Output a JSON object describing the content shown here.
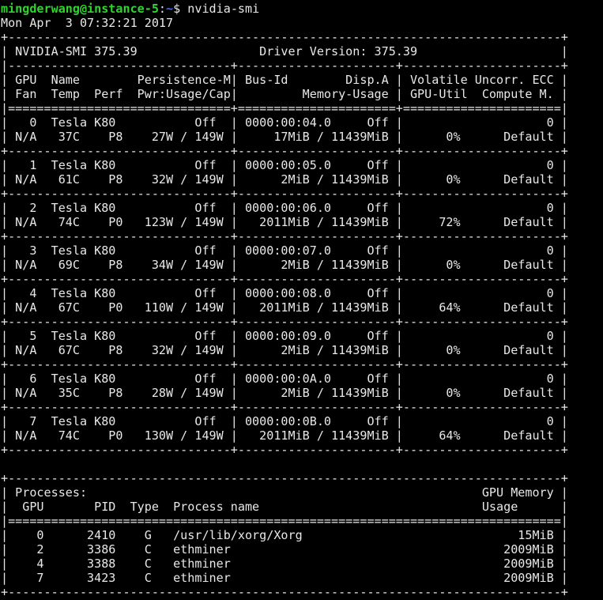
{
  "colors": {
    "background": "#000000",
    "foreground": "#e8e8e8",
    "prompt_user": "#2fd42f",
    "prompt_path": "#3a6bff"
  },
  "prompt": {
    "user_host": "mingderwang@instance-5",
    "separator": ":",
    "path": "~",
    "symbol": "$ ",
    "command": "nvidia-smi"
  },
  "output_lines": [
    "Mon Apr  3 07:32:21 2017",
    "+-----------------------------------------------------------------------------+",
    "| NVIDIA-SMI 375.39                 Driver Version: 375.39                    |",
    "|-------------------------------+----------------------+----------------------+",
    "| GPU  Name        Persistence-M| Bus-Id        Disp.A | Volatile Uncorr. ECC |",
    "| Fan  Temp  Perf  Pwr:Usage/Cap|         Memory-Usage | GPU-Util  Compute M. |",
    "|===============================+======================+======================|",
    "|   0  Tesla K80           Off  | 0000:00:04.0     Off |                    0 |",
    "| N/A   37C    P8    27W / 149W |     17MiB / 11439MiB |      0%      Default |",
    "+-------------------------------+----------------------+----------------------+",
    "|   1  Tesla K80           Off  | 0000:00:05.0     Off |                    0 |",
    "| N/A   61C    P8    32W / 149W |      2MiB / 11439MiB |      0%      Default |",
    "+-------------------------------+----------------------+----------------------+",
    "|   2  Tesla K80           Off  | 0000:00:06.0     Off |                    0 |",
    "| N/A   74C    P0   123W / 149W |   2011MiB / 11439MiB |     72%      Default |",
    "+-------------------------------+----------------------+----------------------+",
    "|   3  Tesla K80           Off  | 0000:00:07.0     Off |                    0 |",
    "| N/A   69C    P8    34W / 149W |      2MiB / 11439MiB |      0%      Default |",
    "+-------------------------------+----------------------+----------------------+",
    "|   4  Tesla K80           Off  | 0000:00:08.0     Off |                    0 |",
    "| N/A   67C    P0   110W / 149W |   2011MiB / 11439MiB |     64%      Default |",
    "+-------------------------------+----------------------+----------------------+",
    "|   5  Tesla K80           Off  | 0000:00:09.0     Off |                    0 |",
    "| N/A   67C    P8    32W / 149W |      2MiB / 11439MiB |      0%      Default |",
    "+-------------------------------+----------------------+----------------------+",
    "|   6  Tesla K80           Off  | 0000:00:0A.0     Off |                    0 |",
    "| N/A   35C    P8    28W / 149W |      2MiB / 11439MiB |      0%      Default |",
    "+-------------------------------+----------------------+----------------------+",
    "|   7  Tesla K80           Off  | 0000:00:0B.0     Off |                    0 |",
    "| N/A   74C    P0   130W / 149W |   2011MiB / 11439MiB |     64%      Default |",
    "+-------------------------------+----------------------+----------------------+",
    "",
    "+-----------------------------------------------------------------------------+",
    "| Processes:                                                       GPU Memory |",
    "|  GPU       PID  Type  Process name                               Usage      |",
    "|=============================================================================|",
    "|    0      2410    G   /usr/lib/xorg/Xorg                              15MiB |",
    "|    2      3386    C   ethminer                                      2009MiB |",
    "|    4      3388    C   ethminer                                      2009MiB |",
    "|    7      3423    C   ethminer                                      2009MiB |",
    "+-----------------------------------------------------------------------------+"
  ]
}
